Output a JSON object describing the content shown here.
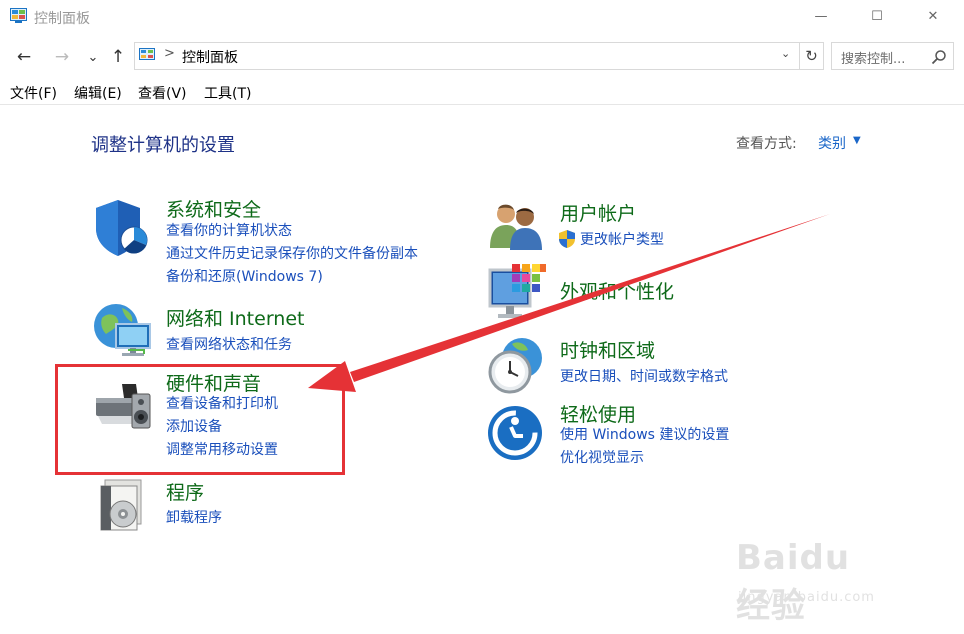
{
  "window": {
    "title": "控制面板",
    "controls": {
      "minimize": "—",
      "maximize": "☐",
      "close": "✕"
    }
  },
  "nav": {
    "back": "←",
    "forward": "→",
    "recent": "⌄",
    "up": "↑",
    "address_separator": ">",
    "address_path": "控制面板",
    "address_dropdown": "⌄",
    "refresh": "↻",
    "search_placeholder": "搜索控制..."
  },
  "menu": [
    "文件(F)",
    "编辑(E)",
    "查看(V)",
    "工具(T)"
  ],
  "content": {
    "heading": "调整计算机的设置",
    "view_by_label": "查看方式:",
    "view_by_value": "类别",
    "view_by_caret": "▼"
  },
  "categories": {
    "left": [
      {
        "icon": "shield-icon",
        "title": "系统和安全",
        "links": [
          "查看你的计算机状态",
          "通过文件历史记录保存你的文件备份副本",
          "备份和还原(Windows 7)"
        ]
      },
      {
        "icon": "network-globe-icon",
        "title": "网络和 Internet",
        "links": [
          "查看网络状态和任务"
        ]
      },
      {
        "icon": "printer-speaker-icon",
        "title": "硬件和声音",
        "links": [
          "查看设备和打印机",
          "添加设备",
          "调整常用移动设置"
        ]
      },
      {
        "icon": "programs-disc-icon",
        "title": "程序",
        "links": [
          "卸载程序"
        ]
      }
    ],
    "right": [
      {
        "icon": "users-icon",
        "title": "用户帐户",
        "links": [
          "更改帐户类型"
        ]
      },
      {
        "icon": "appearance-monitor-icon",
        "title": "外观和个性化",
        "links": []
      },
      {
        "icon": "clock-globe-icon",
        "title": "时钟和区域",
        "links": [
          "更改日期、时间或数字格式"
        ]
      },
      {
        "icon": "ease-of-access-icon",
        "title": "轻松使用",
        "links": [
          "使用 Windows 建议的设置",
          "优化视觉显示"
        ]
      }
    ]
  },
  "watermark": {
    "brand": "Baidu经验",
    "url": "jingyan.baidu.com"
  },
  "colors": {
    "title_green": "#0e6a19",
    "link_blue": "#1a4fbb",
    "heading_blue": "#1e3287",
    "annotation_red": "#e53236"
  }
}
